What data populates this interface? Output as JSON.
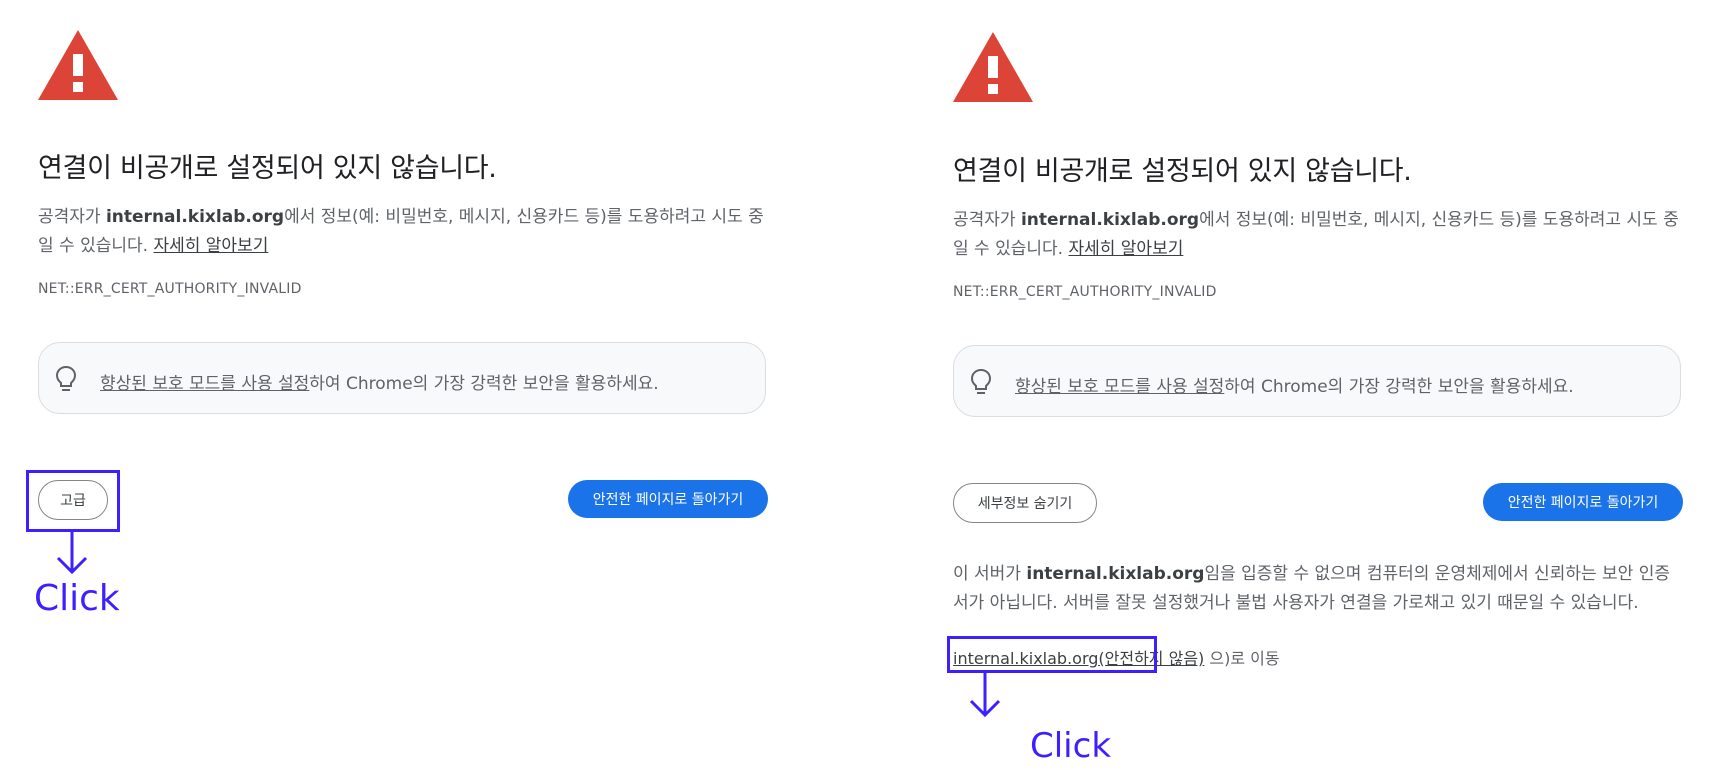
{
  "left": {
    "headline": "연결이 비공개로 설정되어 있지 않습니다.",
    "desc_prefix": "공격자가 ",
    "domain": "internal.kixlab.org",
    "desc_suffix": "에서 정보(예: 비밀번호, 메시지, 신용카드 등)를 도용하려고 시도 중일 수 있습니다. ",
    "learn_more": "자세히 알아보기",
    "error_code": "NET::ERR_CERT_AUTHORITY_INVALID",
    "tip_link": "향상된 보호 모드를 사용 설정",
    "tip_rest": "하여 Chrome의 가장 강력한 보안을 활용하세요.",
    "advanced_button": "고급",
    "back_button": "안전한 페이지로 돌아가기",
    "annotation": "Click"
  },
  "right": {
    "headline": "연결이 비공개로 설정되어 있지 않습니다.",
    "desc_prefix": "공격자가 ",
    "domain": "internal.kixlab.org",
    "desc_suffix": "에서 정보(예: 비밀번호, 메시지, 신용카드 등)를 도용하려고 시도 중일 수 있습니다. ",
    "learn_more": "자세히 알아보기",
    "error_code": "NET::ERR_CERT_AUTHORITY_INVALID",
    "tip_link": "향상된 보호 모드를 사용 설정",
    "tip_rest": "하여 Chrome의 가장 강력한 보안을 활용하세요.",
    "hide_details_button": "세부정보 숨기기",
    "back_button": "안전한 페이지로 돌아가기",
    "detail_prefix": "이 서버가 ",
    "detail_domain": "internal.kixlab.org",
    "detail_suffix": "임을 입증할 수 없으며 컴퓨터의 운영체제에서 신뢰하는 보안 인증서가 아닙니다. 서버를 잘못 설정했거나 불법 사용자가 연결을 가로채고 있기 때문일 수 있습니다.",
    "proceed_link": "internal.kixlab.org(안전하지 않음)",
    "proceed_suffix": "으)로 이동",
    "annotation": "Click"
  },
  "colors": {
    "warning_red": "#db4437",
    "primary_blue": "#1a73e8",
    "annotation_purple": "#3d1fff"
  },
  "icons": [
    "warning-triangle-icon",
    "lightbulb-icon",
    "arrow-down-icon"
  ]
}
